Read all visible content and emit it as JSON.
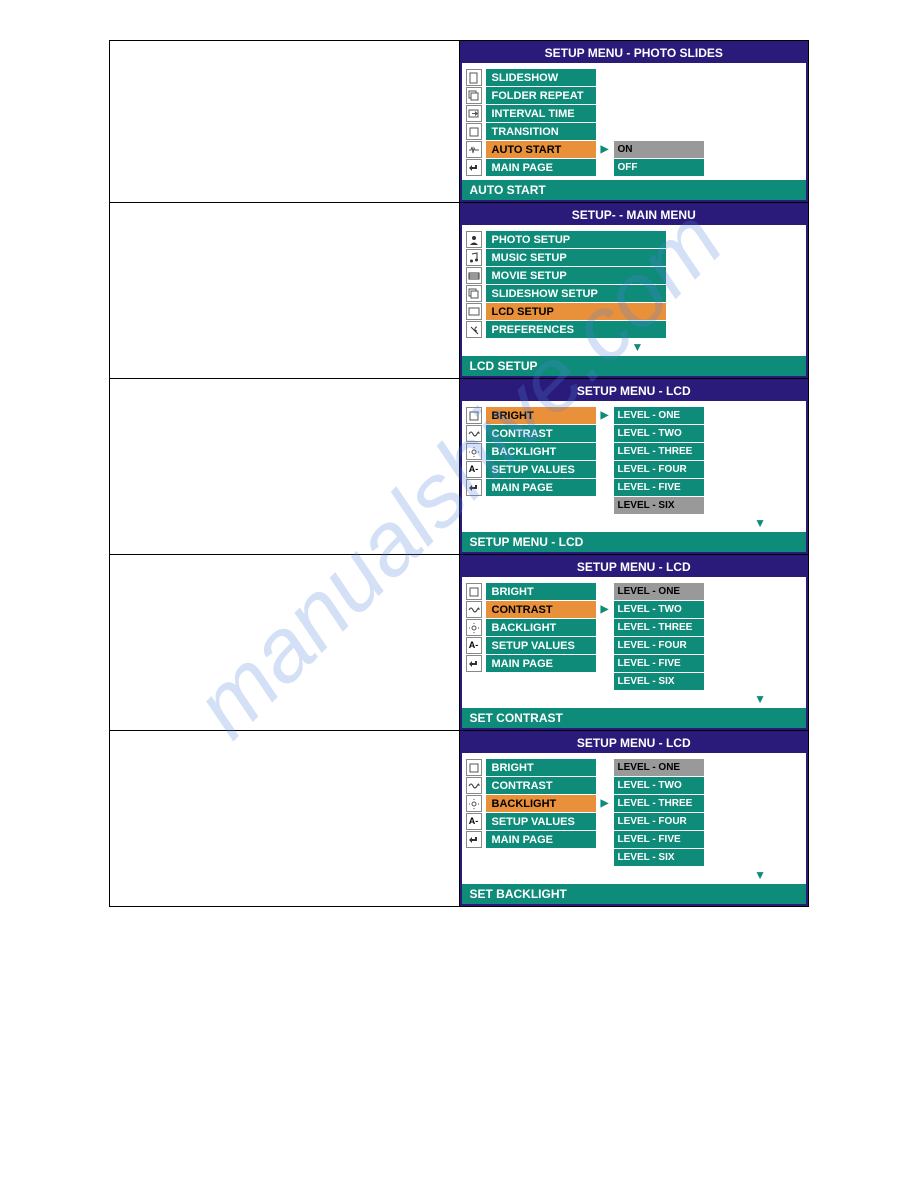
{
  "watermark": "manualshive.com",
  "cards": [
    {
      "title": "SETUP MENU - PHOTO SLIDES",
      "footer": "AUTO START",
      "items": [
        {
          "label": "SLIDESHOW",
          "sel": false,
          "icon": "page"
        },
        {
          "label": "FOLDER REPEAT",
          "sel": false,
          "icon": "stack"
        },
        {
          "label": "INTERVAL TIME",
          "sel": false,
          "icon": "box-arrow"
        },
        {
          "label": "TRANSITION",
          "sel": false,
          "icon": "square"
        },
        {
          "label": "AUTO START",
          "sel": true,
          "icon": "pulse"
        },
        {
          "label": "MAIN PAGE",
          "sel": false,
          "icon": "back"
        }
      ],
      "sub": [
        {
          "label": "",
          "blank": true
        },
        {
          "label": "",
          "blank": true
        },
        {
          "label": "",
          "blank": true
        },
        {
          "label": "",
          "blank": true
        },
        {
          "label": "ON",
          "sel": true
        },
        {
          "label": "OFF",
          "sel": false
        }
      ],
      "arrow_at": 4,
      "down_arrow_after": false
    },
    {
      "title": "SETUP- - MAIN MENU",
      "footer": "LCD SETUP",
      "items": [
        {
          "label": "PHOTO SETUP",
          "sel": false,
          "icon": "person"
        },
        {
          "label": "MUSIC SETUP",
          "sel": false,
          "icon": "music"
        },
        {
          "label": "MOVIE SETUP",
          "sel": false,
          "icon": "film"
        },
        {
          "label": "SLIDESHOW SETUP",
          "sel": false,
          "icon": "stack"
        },
        {
          "label": "LCD SETUP",
          "sel": true,
          "icon": "screen"
        },
        {
          "label": "PREFERENCES",
          "sel": false,
          "icon": "wrench"
        }
      ],
      "sub": null,
      "down_arrow_after": true
    },
    {
      "title": "SETUP MENU - LCD",
      "footer": "SETUP MENU - LCD",
      "items": [
        {
          "label": "BRIGHT",
          "sel": true,
          "icon": "square"
        },
        {
          "label": "CONTRAST",
          "sel": false,
          "icon": "wave"
        },
        {
          "label": "BACKLIGHT",
          "sel": false,
          "icon": "sun"
        },
        {
          "label": "SETUP VALUES",
          "sel": false,
          "icon": "letter"
        },
        {
          "label": "MAIN PAGE",
          "sel": false,
          "icon": "back"
        }
      ],
      "sub": [
        {
          "label": "LEVEL - ONE",
          "sel": false
        },
        {
          "label": "LEVEL - TWO",
          "sel": false
        },
        {
          "label": "LEVEL - THREE",
          "sel": false
        },
        {
          "label": "LEVEL - FOUR",
          "sel": false
        },
        {
          "label": "LEVEL - FIVE",
          "sel": false
        },
        {
          "label": "LEVEL - SIX",
          "sel": true
        }
      ],
      "arrow_at": 0,
      "down_arrow_after": true
    },
    {
      "title": "SETUP MENU - LCD",
      "footer": "SET CONTRAST",
      "items": [
        {
          "label": "BRIGHT",
          "sel": false,
          "icon": "square"
        },
        {
          "label": "CONTRAST",
          "sel": true,
          "icon": "wave"
        },
        {
          "label": "BACKLIGHT",
          "sel": false,
          "icon": "sun"
        },
        {
          "label": "SETUP VALUES",
          "sel": false,
          "icon": "letter"
        },
        {
          "label": "MAIN PAGE",
          "sel": false,
          "icon": "back"
        }
      ],
      "sub": [
        {
          "label": "LEVEL - ONE",
          "sel": true
        },
        {
          "label": "LEVEL - TWO",
          "sel": false
        },
        {
          "label": "LEVEL - THREE",
          "sel": false
        },
        {
          "label": "LEVEL - FOUR",
          "sel": false
        },
        {
          "label": "LEVEL - FIVE",
          "sel": false
        },
        {
          "label": "LEVEL - SIX",
          "sel": false
        }
      ],
      "arrow_at": 1,
      "down_arrow_after": true
    },
    {
      "title": "SETUP MENU - LCD",
      "footer": "SET BACKLIGHT",
      "items": [
        {
          "label": "BRIGHT",
          "sel": false,
          "icon": "square"
        },
        {
          "label": "CONTRAST",
          "sel": false,
          "icon": "wave"
        },
        {
          "label": "BACKLIGHT",
          "sel": true,
          "icon": "sun"
        },
        {
          "label": "SETUP VALUES",
          "sel": false,
          "icon": "letter"
        },
        {
          "label": "MAIN PAGE",
          "sel": false,
          "icon": "back"
        }
      ],
      "sub": [
        {
          "label": "LEVEL - ONE",
          "sel": true
        },
        {
          "label": "LEVEL - TWO",
          "sel": false
        },
        {
          "label": "LEVEL - THREE",
          "sel": false
        },
        {
          "label": "LEVEL - FOUR",
          "sel": false
        },
        {
          "label": "LEVEL - FIVE",
          "sel": false
        },
        {
          "label": "LEVEL - SIX",
          "sel": false
        }
      ],
      "arrow_at": 2,
      "down_arrow_after": true
    }
  ]
}
